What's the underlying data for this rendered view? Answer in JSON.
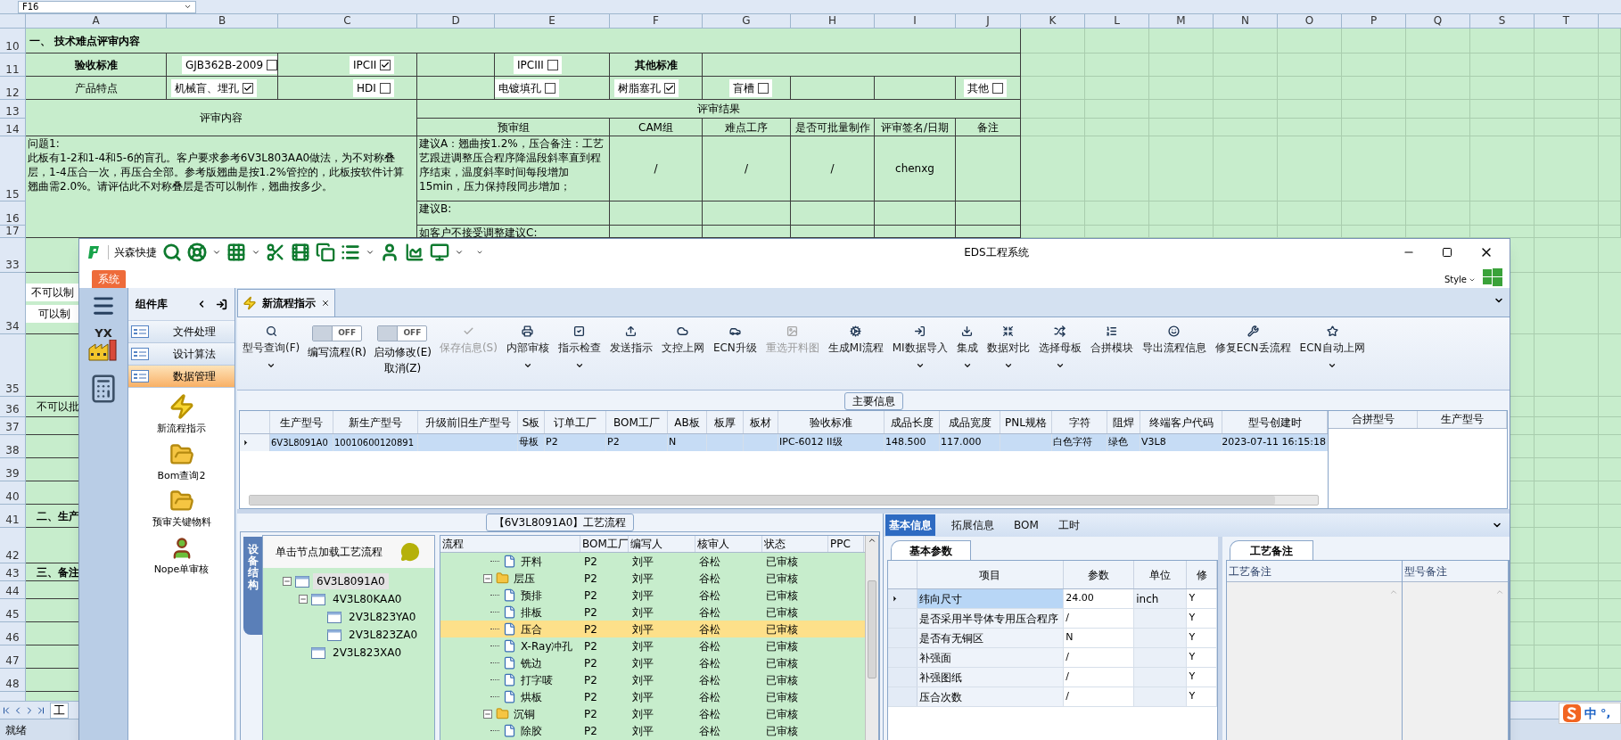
{
  "spreadsheet": {
    "name_box": "F16",
    "columns": [
      "A",
      "B",
      "C",
      "D",
      "E",
      "F",
      "G",
      "H",
      "I",
      "J",
      "K",
      "L",
      "M",
      "N",
      "O",
      "P",
      "Q",
      "S",
      "T"
    ],
    "upper_row_numbers": [
      "10",
      "11",
      "12",
      "13",
      "14",
      "15",
      "16",
      "17"
    ],
    "section_title": "一、 技术难点评审内容",
    "standards": {
      "label": "验收标准",
      "options": [
        {
          "label": "GJB362B-2009",
          "checked": false
        },
        {
          "label": "IPCII",
          "checked": true
        },
        {
          "label": "IPCIII",
          "checked": false
        }
      ],
      "other_label": "其他标准"
    },
    "features": {
      "label": "产品特点",
      "options": [
        {
          "label": "机械盲、埋孔",
          "checked": true
        },
        {
          "label": "HDI",
          "checked": false
        },
        {
          "label": "电镀填孔",
          "checked": false
        },
        {
          "label": "树脂塞孔",
          "checked": true
        },
        {
          "label": "盲槽",
          "checked": false
        },
        {
          "label": "其他",
          "checked": false
        }
      ]
    },
    "review": {
      "content_label": "评审内容",
      "result_label": "评审结果",
      "result_columns": [
        "预审组",
        "CAM组",
        "难点工序",
        "是否可批量制作",
        "评审签名/日期",
        "备注"
      ],
      "question": "问题1:\n此板有1-2和1-4和5-6的盲孔。客户要求参考6V3L803AA0做法，为不对称叠层，1-4压合一次，再压合全部。参考版翘曲是按1.2%管控的，此板按软件计算翘曲需2.0%。请评估此不对称叠层是否可以制作，翘曲按多少。",
      "suggestions": [
        {
          "text": "建议A：翘曲按1.2%，压合备注：工艺艺跟进调整压合程序降温段斜率直到程序结束，温度斜率时间每段增加15min，压力保持段同步增加；",
          "cells": [
            "/",
            "/",
            "/",
            "chenxg"
          ]
        },
        {
          "text": "建议B:"
        },
        {
          "text": "如客户不接受调整建议C:"
        }
      ]
    },
    "lower_rows": [
      {
        "number": "33"
      },
      {
        "number": "34",
        "notes": [
          "不可以制",
          "可以制"
        ]
      },
      {
        "number": "35"
      },
      {
        "number": "36",
        "text": "不可以批"
      },
      {
        "number": "37"
      },
      {
        "number": "38"
      },
      {
        "number": "39"
      },
      {
        "number": "40"
      },
      {
        "number": "41",
        "text": "二、生产",
        "bold": true
      },
      {
        "number": "42"
      },
      {
        "number": "43",
        "text": "三、备注",
        "bold": true
      },
      {
        "number": "44"
      },
      {
        "number": "45"
      },
      {
        "number": "46"
      },
      {
        "number": "47"
      },
      {
        "number": "48"
      }
    ],
    "sheet_tab": "工",
    "status": "就绪",
    "ime_mode": "中",
    "ime_punct": "°,"
  },
  "app": {
    "company": "兴森快捷",
    "title": "EDS工程系统",
    "menu_tab": "系统",
    "style_label": "Style",
    "rail_badge": "YX",
    "library": {
      "title": "组件库",
      "groups": [
        {
          "label": "文件处理",
          "selected": false
        },
        {
          "label": "设计算法",
          "selected": false
        },
        {
          "label": "数据管理",
          "selected": true
        }
      ],
      "tools": [
        "新流程指示",
        "Bom查询2",
        "预审关键物料",
        "Nope单审核"
      ]
    },
    "doc_tabs": [
      {
        "label": "新流程指示",
        "selected": true
      }
    ],
    "ribbon": [
      {
        "kind": "button",
        "label": "型号查询(F)",
        "dropdown": true,
        "disabled": false
      },
      {
        "kind": "toggle",
        "label": "编写流程(R)",
        "switch_text": "OFF",
        "on": false
      },
      {
        "kind": "toggle",
        "label": "启动修改(E)",
        "sub_label": "取消(Z)",
        "switch_text": "OFF",
        "on": false
      },
      {
        "kind": "button",
        "label": "保存信息(S)",
        "dropdown": false,
        "disabled": true
      },
      {
        "kind": "button",
        "label": "内部审核",
        "dropdown": true,
        "disabled": false
      },
      {
        "kind": "button",
        "label": "指示检查",
        "dropdown": true,
        "disabled": false
      },
      {
        "kind": "button",
        "label": "发送指示",
        "dropdown": false,
        "disabled": false
      },
      {
        "kind": "button",
        "label": "文控上网",
        "dropdown": false,
        "disabled": false
      },
      {
        "kind": "button",
        "label": "ECN升级",
        "dropdown": false,
        "disabled": false
      },
      {
        "kind": "button",
        "label": "重选开料图",
        "dropdown": false,
        "disabled": true
      },
      {
        "kind": "button",
        "label": "生成MI流程",
        "dropdown": false,
        "disabled": false
      },
      {
        "kind": "button",
        "label": "MI数据导入",
        "dropdown": true,
        "disabled": false
      },
      {
        "kind": "button",
        "label": "集成",
        "dropdown": true,
        "disabled": false
      },
      {
        "kind": "button",
        "label": "数据对比",
        "dropdown": true,
        "disabled": false
      },
      {
        "kind": "button",
        "label": "选择母板",
        "dropdown": true,
        "disabled": false
      },
      {
        "kind": "button",
        "label": "合拼模块",
        "dropdown": false,
        "disabled": false
      },
      {
        "kind": "button",
        "label": "导出流程信息",
        "dropdown": false,
        "disabled": false
      },
      {
        "kind": "button",
        "label": "修复ECN丢流程",
        "dropdown": false,
        "disabled": false
      },
      {
        "kind": "button",
        "label": "ECN自动上网",
        "dropdown": true,
        "disabled": false
      }
    ],
    "main_info": {
      "title": "主要信息",
      "columns": [
        "生产型号",
        "新生产型号",
        "升级前旧生产型号",
        "S板",
        "订单工厂",
        "BOM工厂",
        "AB板",
        "板厚",
        "板材",
        "验收标准",
        "成品长度",
        "成品宽度",
        "PNL规格",
        "字符",
        "阻焊",
        "终端客户代码",
        "型号创建时"
      ],
      "rows": [
        {
          "selected": true,
          "cells": [
            "6V3L8091A0",
            "10010600120891",
            "",
            "母板",
            "P2",
            "P2",
            "N",
            "",
            "",
            "IPC-6012 II级",
            "148.500",
            "117.000",
            "",
            "白色字符",
            "绿色",
            "V3L8",
            "2023-07-11 16:15:18"
          ]
        }
      ],
      "side_columns": [
        "合拼型号",
        "生产型号"
      ]
    },
    "process": {
      "title": "【6V3L8091A0】工艺流程",
      "side_tab": "设备结构",
      "tree_hint": "单击节点加载工艺流程",
      "tree": [
        {
          "label": "6V3L8091A0",
          "selected": true,
          "expanded": true,
          "children": [
            {
              "label": "4V3L80KAA0",
              "selected": false,
              "expanded": true,
              "children": [
                {
                  "label": "2V3L823YA0",
                  "selected": false
                },
                {
                  "label": "2V3L823ZA0",
                  "selected": false
                }
              ]
            },
            {
              "label": "2V3L823XA0",
              "selected": false
            }
          ]
        }
      ],
      "columns": [
        "流程",
        "BOM工厂",
        "编写人",
        "核审人",
        "状态",
        "PPC"
      ],
      "rows": [
        {
          "kind": "step",
          "name": "开料",
          "bom": "P2",
          "writer": "刘平",
          "reviewer": "谷松",
          "status": "已审核",
          "selected": false
        },
        {
          "kind": "folder",
          "name": "层压",
          "bom": "P2",
          "writer": "刘平",
          "reviewer": "谷松",
          "status": "已审核",
          "selected": false,
          "expanded": true,
          "children": [
            {
              "kind": "step",
              "name": "预排",
              "bom": "P2",
              "writer": "刘平",
              "reviewer": "谷松",
              "status": "已审核",
              "selected": false
            },
            {
              "kind": "step",
              "name": "排板",
              "bom": "P2",
              "writer": "刘平",
              "reviewer": "谷松",
              "status": "已审核",
              "selected": false
            },
            {
              "kind": "step",
              "name": "压合",
              "bom": "P2",
              "writer": "刘平",
              "reviewer": "谷松",
              "status": "已审核",
              "selected": true
            },
            {
              "kind": "step",
              "name": "X-Ray冲孔",
              "bom": "P2",
              "writer": "刘平",
              "reviewer": "谷松",
              "status": "已审核",
              "selected": false
            },
            {
              "kind": "step",
              "name": "铣边",
              "bom": "P2",
              "writer": "刘平",
              "reviewer": "谷松",
              "status": "已审核",
              "selected": false
            },
            {
              "kind": "step",
              "name": "打字唛",
              "bom": "P2",
              "writer": "刘平",
              "reviewer": "谷松",
              "status": "已审核",
              "selected": false
            },
            {
              "kind": "step",
              "name": "烘板",
              "bom": "P2",
              "writer": "刘平",
              "reviewer": "谷松",
              "status": "已审核",
              "selected": false
            }
          ]
        },
        {
          "kind": "folder",
          "name": "沉铜",
          "bom": "P2",
          "writer": "刘平",
          "reviewer": "谷松",
          "status": "已审核",
          "selected": false,
          "expanded": true,
          "children": [
            {
              "kind": "step",
              "name": "除胶",
              "bom": "P2",
              "writer": "刘平",
              "reviewer": "谷松",
              "status": "已审核",
              "selected": false
            }
          ]
        }
      ]
    },
    "detail": {
      "tabs": [
        {
          "label": "基本信息",
          "selected": true
        },
        {
          "label": "拓展信息",
          "selected": false
        },
        {
          "label": "BOM",
          "selected": false
        },
        {
          "label": "工时",
          "selected": false
        }
      ],
      "params": {
        "tab": "基本参数",
        "columns": [
          "项目",
          "参数",
          "单位",
          "修"
        ],
        "rows": [
          {
            "selected": true,
            "cells": [
              "纬向尺寸",
              "24.00",
              "inch",
              "Y"
            ]
          },
          {
            "selected": false,
            "cells": [
              "是否采用半导体专用压合程序",
              "/",
              "",
              "Y"
            ]
          },
          {
            "selected": false,
            "cells": [
              "是否有无铜区",
              "N",
              "",
              "Y"
            ]
          },
          {
            "selected": false,
            "cells": [
              "补强面",
              "/",
              "",
              "Y"
            ]
          },
          {
            "selected": false,
            "cells": [
              "补强图纸",
              "/",
              "",
              "Y"
            ]
          },
          {
            "selected": false,
            "cells": [
              "压合次数",
              "/",
              "",
              "Y"
            ]
          }
        ]
      },
      "notes": {
        "tab": "工艺备注",
        "columns": [
          "工艺备注",
          "型号备注"
        ]
      }
    }
  }
}
